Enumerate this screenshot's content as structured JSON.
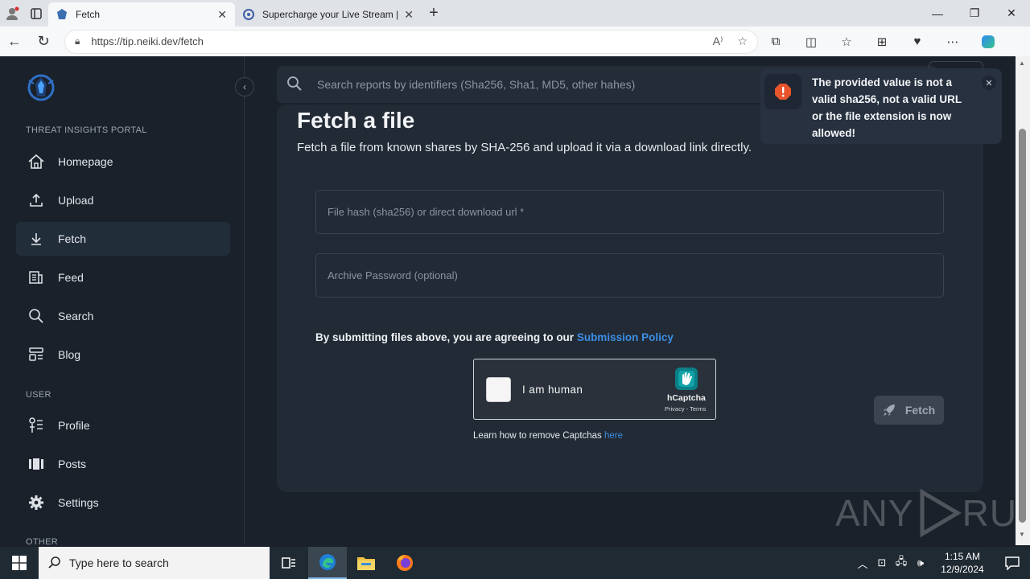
{
  "browser": {
    "tabs": [
      {
        "title": "Fetch",
        "active": true
      },
      {
        "title": "Supercharge your Live Stream | S",
        "active": false
      }
    ],
    "url": "https://tip.neiki.dev/fetch"
  },
  "sidebar": {
    "section_portal": "THREAT INSIGHTS PORTAL",
    "section_user": "USER",
    "section_other": "OTHER",
    "items": [
      {
        "label": "Homepage",
        "icon": "home-icon"
      },
      {
        "label": "Upload",
        "icon": "upload-icon"
      },
      {
        "label": "Fetch",
        "icon": "download-icon",
        "active": true
      },
      {
        "label": "Feed",
        "icon": "feed-icon"
      },
      {
        "label": "Search",
        "icon": "search-icon"
      },
      {
        "label": "Blog",
        "icon": "blog-icon"
      },
      {
        "label": "Profile",
        "icon": "profile-icon"
      },
      {
        "label": "Posts",
        "icon": "posts-icon"
      },
      {
        "label": "Settings",
        "icon": "gear-icon"
      }
    ]
  },
  "search": {
    "placeholder": "Search reports by identifiers (Sha256, Sha1, MD5, other hahes)"
  },
  "main": {
    "title": "Fetch a file",
    "subtitle": "Fetch a file from known shares by SHA-256 and upload it via a download link directly.",
    "hash_placeholder": "File hash (sha256) or direct download url *",
    "password_placeholder": "Archive Password (optional)",
    "policy_text": "By submitting files above, you are agreeing to our ",
    "policy_link": "Submission Policy",
    "captcha_label": "I am human",
    "captcha_brand": "hCaptcha",
    "captcha_terms": "Privacy - Terms",
    "learn_text": "Learn how to remove Captchas ",
    "learn_link": "here",
    "fetch_label": "Fetch"
  },
  "toast": {
    "message": "The provided value is not a valid sha256, not a valid URL or the file extension is now allowed!",
    "color": "#e8542c"
  },
  "watermark": {
    "left": "ANY",
    "right": "RUN"
  },
  "taskbar": {
    "search_placeholder": "Type here to search",
    "time": "1:15 AM",
    "date": "12/9/2024"
  }
}
